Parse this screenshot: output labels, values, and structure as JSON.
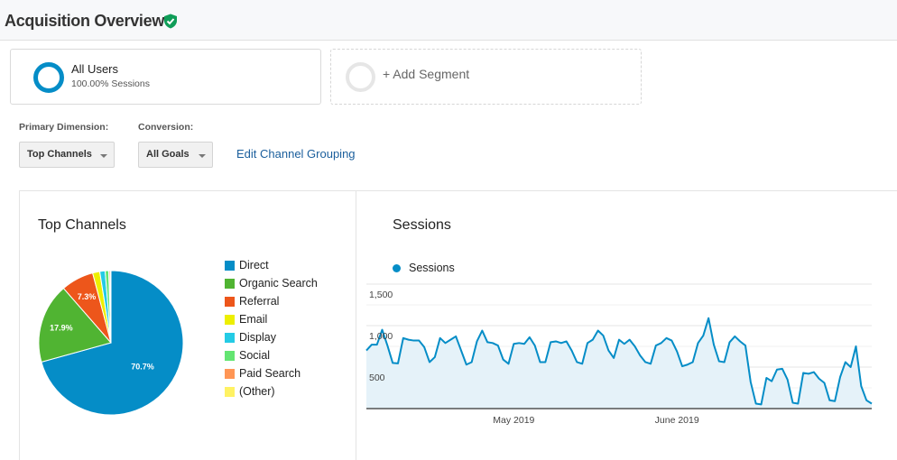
{
  "header": {
    "title": "Acquisition Overview",
    "verified_icon": "shield-check-icon"
  },
  "segments": {
    "active": {
      "name": "All Users",
      "sub": "100.00% Sessions",
      "ring_color": "#058dc7"
    },
    "add_label": "+ Add Segment"
  },
  "controls": {
    "primary_dimension_label": "Primary Dimension:",
    "primary_dimension_value": "Top Channels",
    "conversion_label": "Conversion:",
    "conversion_value": "All Goals",
    "edit_link": "Edit Channel Grouping"
  },
  "panels": {
    "left_title": "Top Channels",
    "right_title": "Sessions"
  },
  "chart_data": [
    {
      "type": "pie",
      "title": "Top Channels",
      "legend_position": "right",
      "slices": [
        {
          "label": "Direct",
          "value": 70.7,
          "color": "#058dc7",
          "show_label": true
        },
        {
          "label": "Organic Search",
          "value": 17.9,
          "color": "#50b432",
          "show_label": true
        },
        {
          "label": "Referral",
          "value": 7.3,
          "color": "#ed561b",
          "show_label": true
        },
        {
          "label": "Email",
          "value": 1.6,
          "color": "#edef00",
          "show_label": false
        },
        {
          "label": "Display",
          "value": 1.2,
          "color": "#24cbe5",
          "show_label": false
        },
        {
          "label": "Social",
          "value": 0.8,
          "color": "#64e572",
          "show_label": false
        },
        {
          "label": "Paid Search",
          "value": 0.3,
          "color": "#ff9655",
          "show_label": false
        },
        {
          "label": "(Other)",
          "value": 0.2,
          "color": "#fff263",
          "show_label": false
        }
      ]
    },
    {
      "type": "area",
      "title": "Sessions",
      "legend": [
        "Sessions"
      ],
      "legend_position": "top-left",
      "color": "#058dc7",
      "fill": "#e5f2f9",
      "ylim": [
        0,
        1500
      ],
      "yticks": [
        500,
        1000,
        1500
      ],
      "ytick_labels": [
        "500",
        "1,000",
        "1,500"
      ],
      "grid": true,
      "xtick_labels": [
        {
          "label": "May 2019",
          "index": 28
        },
        {
          "label": "June 2019",
          "index": 59
        }
      ],
      "values": [
        700,
        770,
        770,
        950,
        760,
        550,
        545,
        850,
        830,
        820,
        820,
        740,
        560,
        620,
        850,
        790,
        830,
        870,
        700,
        530,
        560,
        810,
        940,
        800,
        790,
        760,
        590,
        540,
        780,
        790,
        780,
        860,
        760,
        560,
        560,
        800,
        810,
        790,
        810,
        700,
        560,
        540,
        790,
        830,
        940,
        880,
        700,
        610,
        830,
        780,
        830,
        750,
        640,
        560,
        540,
        760,
        790,
        850,
        820,
        690,
        510,
        530,
        560,
        790,
        880,
        1090,
        770,
        570,
        560,
        800,
        870,
        810,
        760,
        320,
        60,
        50,
        370,
        330,
        470,
        480,
        350,
        70,
        60,
        430,
        420,
        440,
        360,
        310,
        100,
        90,
        380,
        560,
        500,
        750,
        270,
        100,
        60
      ]
    }
  ]
}
